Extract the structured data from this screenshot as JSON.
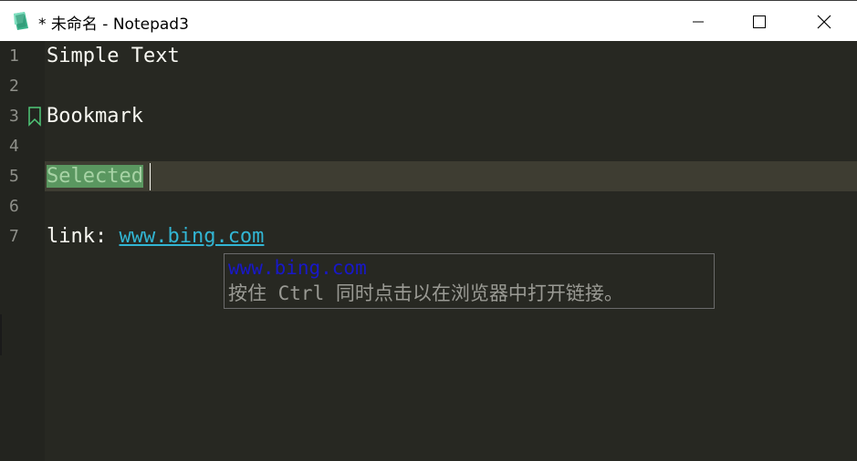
{
  "window": {
    "title": "* 未命名 - Notepad3",
    "minimize_label": "",
    "maximize_label": "",
    "close_label": ""
  },
  "editor": {
    "lines": [
      {
        "number": "1",
        "text": "Simple Text"
      },
      {
        "number": "2",
        "text": ""
      },
      {
        "number": "3",
        "text": "Bookmark"
      },
      {
        "number": "4",
        "text": ""
      },
      {
        "number": "5",
        "text": "Selected"
      },
      {
        "number": "6",
        "text": ""
      },
      {
        "number": "7",
        "prefix": "link: ",
        "link": "www.bing.com"
      }
    ],
    "bookmarked_line": "3",
    "selected_line": "5"
  },
  "tooltip": {
    "url": "www.bing.com",
    "hint": "按住 Ctrl 同时点击以在浏览器中打开链接。"
  },
  "icons": {
    "app": "notepad3-app-icon",
    "bookmark": "bookmark-icon",
    "minimize": "minimize-icon",
    "maximize": "maximize-icon",
    "close": "close-icon"
  },
  "colors": {
    "editor_background": "#272822",
    "gutter_background": "#23241f",
    "current_line": "#3e3d32",
    "selection": "#5a9760",
    "link": "#32b5d3",
    "bookmark": "#50c878",
    "tooltip_url": "#1818c8"
  }
}
